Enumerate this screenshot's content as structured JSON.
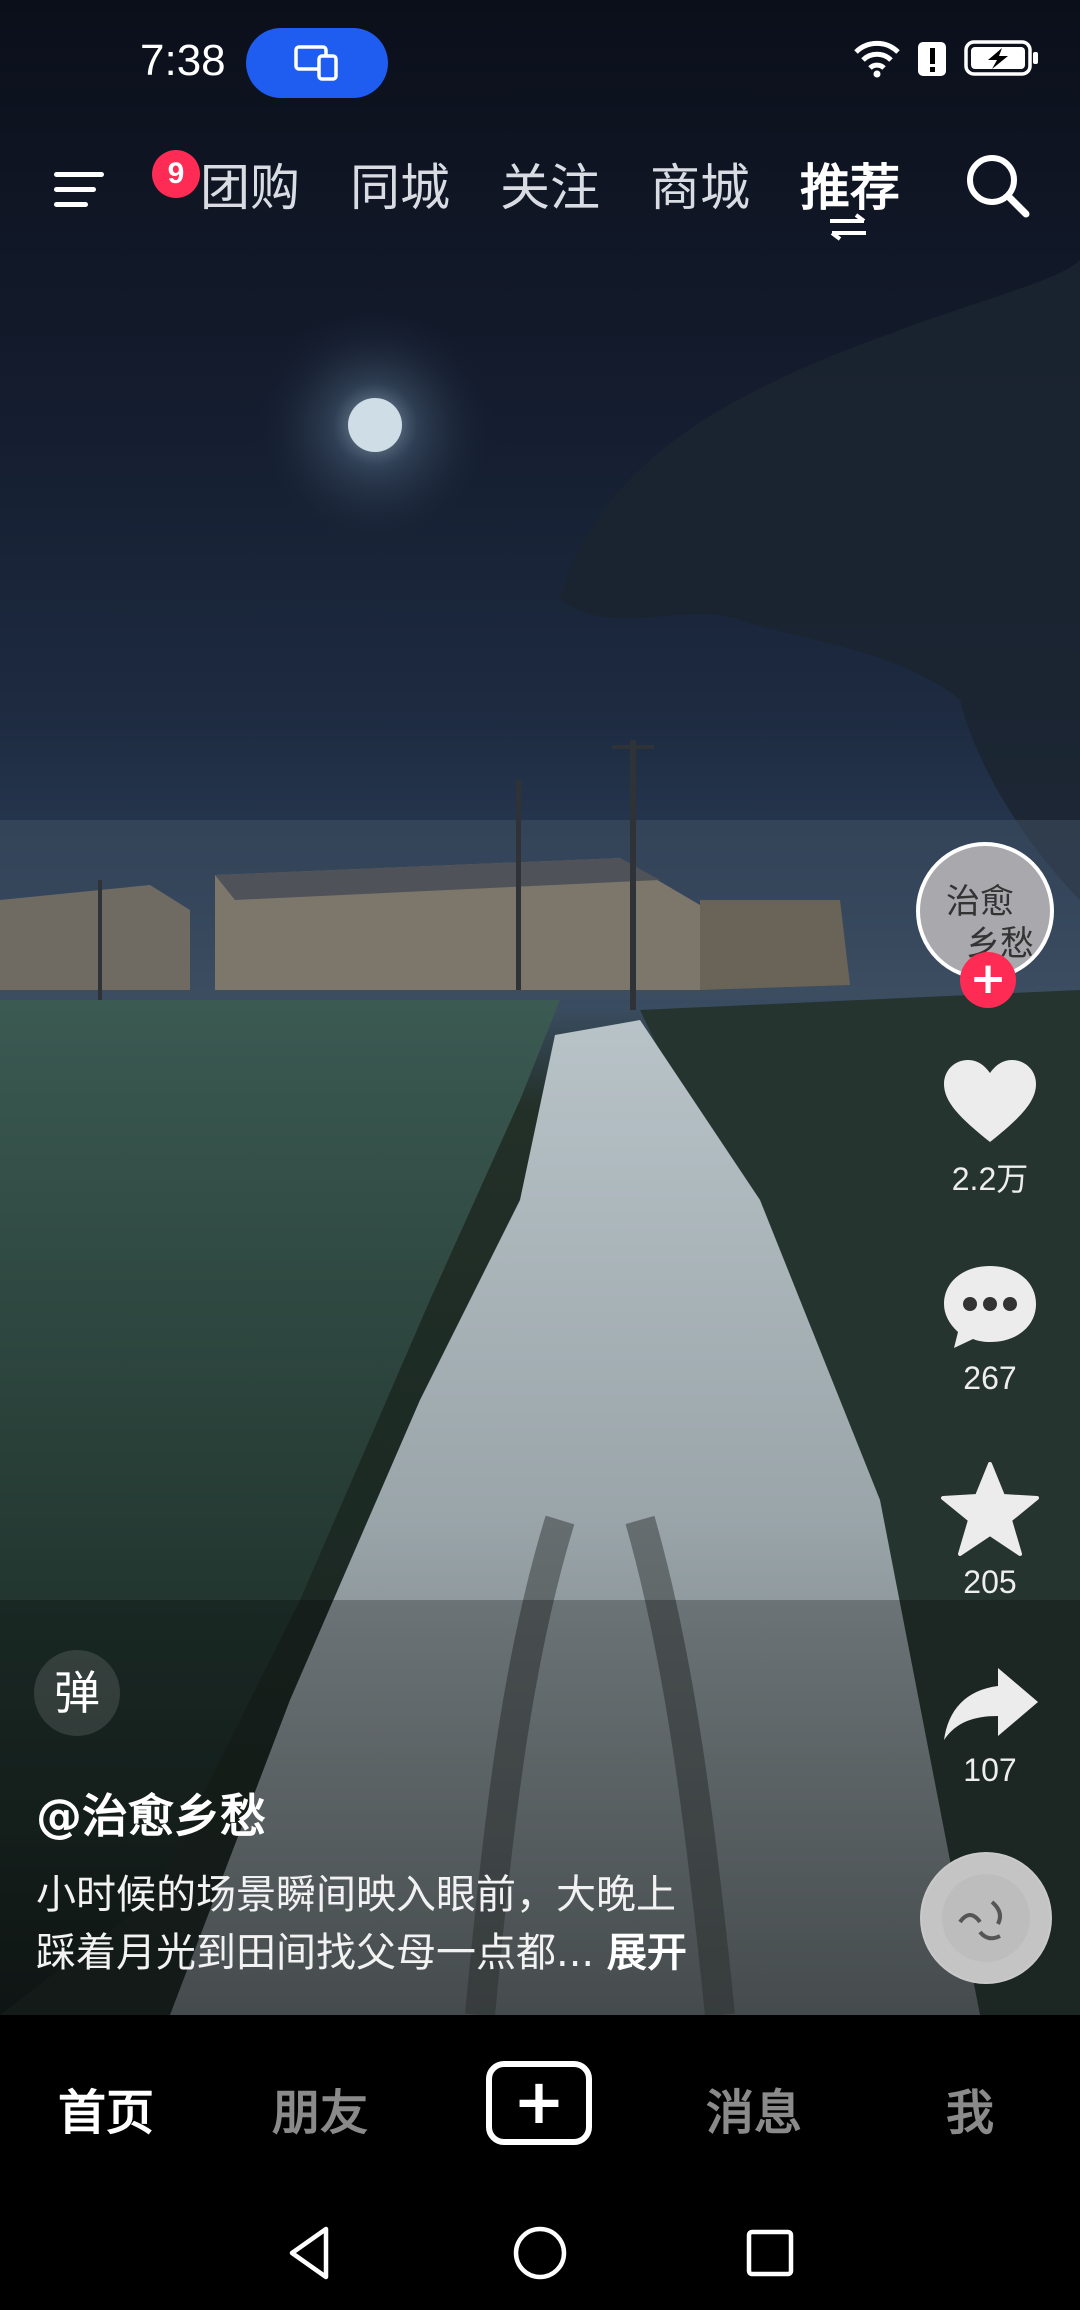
{
  "status_bar": {
    "time": "7:38",
    "icons": [
      "screen-cast-icon",
      "wifi-icon",
      "alert-icon",
      "battery-charging-icon"
    ]
  },
  "top_nav": {
    "menu_badge": "9",
    "tabs": [
      {
        "label": "团购"
      },
      {
        "label": "同城"
      },
      {
        "label": "关注"
      },
      {
        "label": "商城"
      },
      {
        "label": "推荐",
        "active": true
      }
    ]
  },
  "video": {
    "author_avatar_text": [
      "治愈",
      "乡愁"
    ],
    "likes": "2.2万",
    "comments": "267",
    "favorites": "205",
    "shares": "107",
    "danmu_label": "弹",
    "author": "@治愈乡愁",
    "description_line1": "小时候的场景瞬间映入眼前，大晚上",
    "description_line2": "踩着月光到田间找父母一点都...",
    "expand_label": "展开"
  },
  "bottom_tabs": {
    "home": "首页",
    "friends": "朋友",
    "messages": "消息",
    "me": "我",
    "active": "首页"
  },
  "colors": {
    "accent": "#fe2c55",
    "cast_pill": "#1f5cf0",
    "tabbar_bg": "#000000"
  }
}
